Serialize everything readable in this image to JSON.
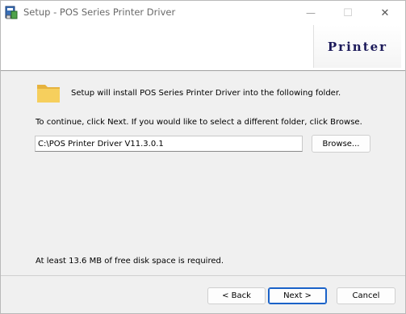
{
  "window": {
    "title": "Setup - POS Series Printer Driver",
    "caption_buttons": {
      "minimize": "—",
      "maximize": "☐",
      "close": "✕"
    }
  },
  "header": {
    "logo_text": "Printer"
  },
  "body": {
    "intro": "Setup will install POS Series Printer Driver into the following folder.",
    "continue": "To continue, click Next. If you would like to select a different folder, click Browse.",
    "install_path": "C:\\POS Printer Driver V11.3.0.1",
    "browse_label": "Browse...",
    "disk_space": "At least 13.6 MB of free disk space is required."
  },
  "footer": {
    "back_label": "< Back",
    "next_label": "Next >",
    "cancel_label": "Cancel"
  },
  "colors": {
    "logo": "#1c1a5a",
    "next_border": "#1a62c8",
    "folder": "#f2c94c"
  }
}
